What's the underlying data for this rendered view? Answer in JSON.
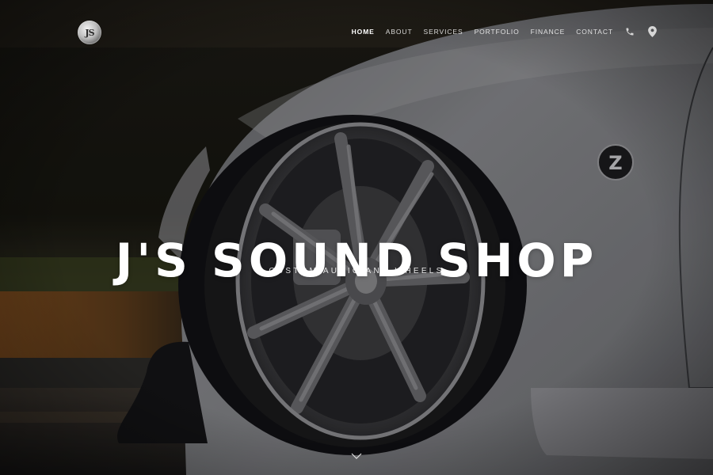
{
  "brand": {
    "logo_text": "JS"
  },
  "nav": {
    "items": [
      {
        "label": "HOME",
        "active": true
      },
      {
        "label": "ABOUT",
        "active": false
      },
      {
        "label": "SERVICES",
        "active": false
      },
      {
        "label": "PORTFOLIO",
        "active": false
      },
      {
        "label": "FINANCE",
        "active": false
      },
      {
        "label": "CONTACT",
        "active": false
      }
    ],
    "icons": [
      "phone-icon",
      "map-pin-icon"
    ]
  },
  "hero": {
    "title": "J'S SOUND SHOP",
    "subtitle": "CUSTOM AUDIO AND WHEELS",
    "background": "white-sports-car-wheel-photo",
    "badge_letter": "Z"
  },
  "scroll": {
    "icon": "chevron-down-icon"
  },
  "colors": {
    "nav_text": "#d1d1d1",
    "title": "#ffffff",
    "background_dark": "#0d0d0f"
  }
}
